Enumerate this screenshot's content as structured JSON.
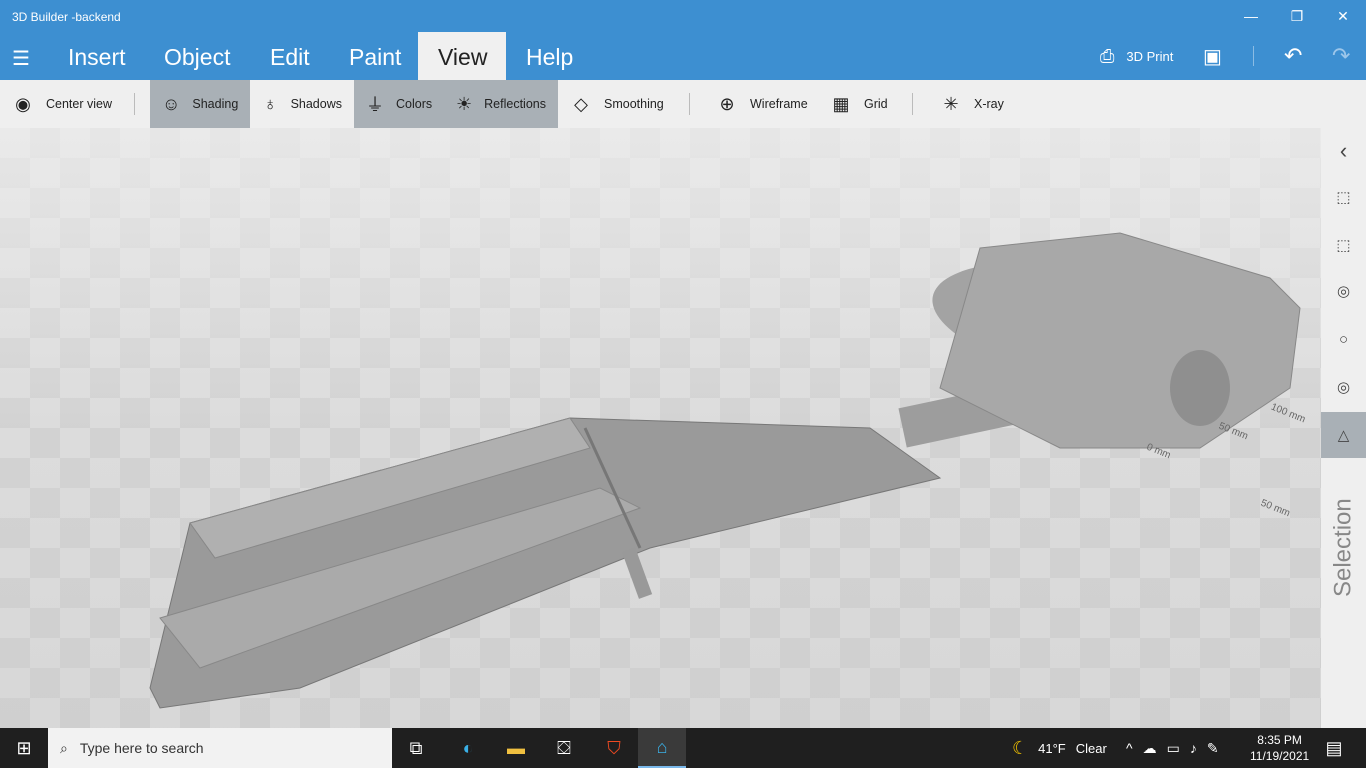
{
  "window": {
    "title": "3D Builder -backend",
    "minimize": "—",
    "maximize": "❐",
    "close": "✕"
  },
  "menu": {
    "tabs": [
      "Insert",
      "Object",
      "Edit",
      "Paint",
      "View",
      "Help"
    ],
    "active": "View",
    "print_label": "3D Print"
  },
  "toolbar": {
    "items": [
      {
        "label": "Center view",
        "icon": "eye-icon",
        "on": false
      },
      {
        "label": "Shading",
        "icon": "face-icon",
        "on": true
      },
      {
        "label": "Shadows",
        "icon": "bulb-icon",
        "on": false
      },
      {
        "label": "Colors",
        "icon": "marker-icon",
        "on": true
      },
      {
        "label": "Reflections",
        "icon": "sunrise-icon",
        "on": true
      },
      {
        "label": "Smoothing",
        "icon": "diamond-icon",
        "on": false
      },
      {
        "label": "Wireframe",
        "icon": "globe-icon",
        "on": false
      },
      {
        "label": "Grid",
        "icon": "grid-icon",
        "on": false
      },
      {
        "label": "X-ray",
        "icon": "asterisk-icon",
        "on": false
      }
    ]
  },
  "viewport": {
    "scale_labels": [
      "100 mm",
      "50 mm",
      "0 mm",
      "50 mm"
    ]
  },
  "side_panel": {
    "label": "Selection"
  },
  "taskbar": {
    "search_placeholder": "Type here to search",
    "weather_temp": "41°F",
    "weather_cond": "Clear",
    "time": "8:35 PM",
    "date": "11/19/2021"
  }
}
